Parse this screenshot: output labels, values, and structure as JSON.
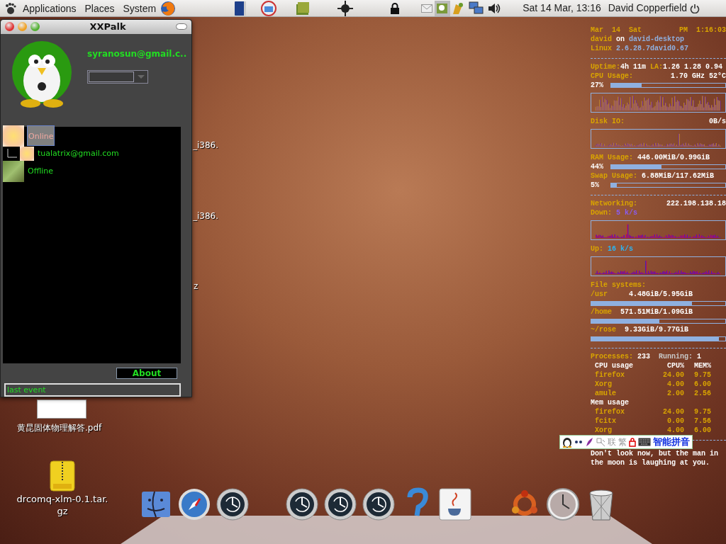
{
  "top_panel": {
    "menus": [
      "Applications",
      "Places",
      "System"
    ],
    "clock": "Sat 14 Mar, 13:16",
    "user": "David Copperfield"
  },
  "desktop_icons": [
    {
      "kind": "label",
      "label": "_i386."
    },
    {
      "kind": "label",
      "label": "_i386."
    },
    {
      "kind": "label",
      "label": "z"
    },
    {
      "kind": "document",
      "label": "黄昆固体物理解答.pdf"
    },
    {
      "kind": "archive",
      "label": "drcomq-xlm-0.1.tar.gz"
    }
  ],
  "xxpalk": {
    "title": "XXPalk",
    "account": "syranosun@gmail.c..",
    "contacts": [
      {
        "label": "Online",
        "selected": true,
        "children": [
          {
            "label": "tualatrix@gmail.com",
            "selected": false
          }
        ]
      },
      {
        "label": "Offline",
        "selected": false
      }
    ],
    "about_button": "About",
    "status_field": {
      "value": "last event"
    }
  },
  "conky": {
    "rows": [
      {
        "kind": "text",
        "left": [
          {
            "text": "Mar  14  Sat",
            "color": "#d9a400"
          }
        ],
        "right": [
          {
            "text": "PM  1:16:03",
            "color": "#d9a400"
          }
        ]
      },
      {
        "kind": "text",
        "left": [
          {
            "text": "david",
            "color": "#d9a400"
          },
          {
            "text": " on ",
            "color": "#ffffff"
          },
          {
            "text": "david-desktop",
            "color": "#8fb0e0"
          }
        ]
      },
      {
        "kind": "text",
        "left": [
          {
            "text": "Linux ",
            "color": "#d9a400"
          },
          {
            "text": "2.6.28.7david0.67",
            "color": "#8fb0e0"
          }
        ]
      },
      {
        "kind": "separator"
      },
      {
        "kind": "text",
        "left": [
          {
            "text": "Uptime:",
            "color": "#d9a400"
          },
          {
            "text": "4h 11m ",
            "color": "#ffffff"
          },
          {
            "text": "LA:",
            "color": "#d9a400"
          },
          {
            "text": "1.26 1.28 0.94",
            "color": "#ffffff"
          }
        ]
      },
      {
        "kind": "text",
        "left": [
          {
            "text": "CPU Usage:",
            "color": "#d9a400"
          }
        ],
        "right": [
          {
            "text": "1.70 GHz 52°C",
            "color": "#ffffff"
          }
        ]
      },
      {
        "kind": "bar",
        "text": "27%",
        "level": 0.27
      },
      {
        "kind": "graph"
      },
      {
        "kind": "text",
        "left": [
          {
            "text": "Disk IO:",
            "color": "#d9a400"
          }
        ],
        "right": [
          {
            "text": "0B/s",
            "color": "#ffffff"
          }
        ]
      },
      {
        "kind": "graph"
      },
      {
        "kind": "text",
        "left": [
          {
            "text": "RAM Usage: ",
            "color": "#d9a400"
          },
          {
            "text": "446.00MiB/0.99GiB",
            "color": "#ffffff"
          }
        ]
      },
      {
        "kind": "bar",
        "text": "44%",
        "level": 0.44
      },
      {
        "kind": "text",
        "left": [
          {
            "text": "Swap Usage: ",
            "color": "#d9a400"
          },
          {
            "text": "6.88MiB/117.62MiB",
            "color": "#ffffff"
          }
        ]
      },
      {
        "kind": "bar",
        "text": "5%",
        "level": 0.05
      },
      {
        "kind": "separator"
      },
      {
        "kind": "text",
        "left": [
          {
            "text": "Networking:",
            "color": "#d9a400"
          }
        ],
        "right": [
          {
            "text": "222.198.138.18",
            "color": "#ffffff"
          }
        ]
      },
      {
        "kind": "text",
        "left": [
          {
            "text": "Down: ",
            "color": "#d9a400"
          },
          {
            "text": "5 k/s",
            "color": "#8a5cf0"
          }
        ]
      },
      {
        "kind": "graph"
      },
      {
        "kind": "text",
        "left": [
          {
            "text": "Up: ",
            "color": "#d9a400"
          },
          {
            "text": "16 k/s",
            "color": "#29b6f6"
          }
        ]
      },
      {
        "kind": "graph"
      },
      {
        "kind": "text",
        "left": [
          {
            "text": "File systems:",
            "color": "#d9a400"
          }
        ]
      },
      {
        "kind": "text",
        "left": [
          {
            "text": "/usr     ",
            "color": "#d9a400"
          },
          {
            "text": "4.48GiB/5.95GiB",
            "color": "#ffffff"
          }
        ]
      },
      {
        "kind": "bar",
        "level": 0.75
      },
      {
        "kind": "text",
        "left": [
          {
            "text": "/home  ",
            "color": "#d9a400"
          },
          {
            "text": "571.51MiB/1.09GiB",
            "color": "#ffffff"
          }
        ]
      },
      {
        "kind": "bar",
        "level": 0.51
      },
      {
        "kind": "text",
        "left": [
          {
            "text": "~/rose  ",
            "color": "#d9a400"
          },
          {
            "text": "9.33GiB/9.77GiB",
            "color": "#ffffff"
          }
        ]
      },
      {
        "kind": "bar",
        "level": 0.95
      },
      {
        "kind": "separator"
      },
      {
        "kind": "text",
        "left": [
          {
            "text": "Processes: ",
            "color": "#d9a400"
          },
          {
            "text": "233  ",
            "color": "#ffffff"
          },
          {
            "text": "Running: ",
            "color": "#c8c8c8"
          },
          {
            "text": "1",
            "color": "#ffffff"
          }
        ]
      },
      {
        "kind": "proc",
        "color": "#ffffff",
        "cells": [
          "CPU usage",
          "CPU%",
          "MEM%"
        ]
      },
      {
        "kind": "proc",
        "color": "#d9a400",
        "cells": [
          "firefox",
          "24.00",
          "9.75"
        ]
      },
      {
        "kind": "proc",
        "color": "#d9a400",
        "cells": [
          "Xorg",
          "4.00",
          "6.00"
        ]
      },
      {
        "kind": "proc",
        "color": "#d9a400",
        "cells": [
          "amule",
          "2.00",
          "2.56"
        ]
      },
      {
        "kind": "proc",
        "color": "#ffffff",
        "cells": [
          "Mem usage"
        ]
      },
      {
        "kind": "proc",
        "color": "#d9a400",
        "cells": [
          "firefox",
          "24.00",
          "9.75"
        ]
      },
      {
        "kind": "proc",
        "color": "#d9a400",
        "cells": [
          "fcitx",
          "0.00",
          "7.56"
        ]
      },
      {
        "kind": "proc",
        "color": "#d9a400",
        "cells": [
          "Xorg",
          "4.00",
          "6.00"
        ]
      },
      {
        "kind": "separator"
      },
      {
        "kind": "paragraph",
        "text": "Don't look now, but the man in the moon is laughing at you."
      }
    ]
  },
  "input_method_bar": {
    "glyphs": [
      "联",
      "繁"
    ],
    "label": "智能拼音"
  }
}
